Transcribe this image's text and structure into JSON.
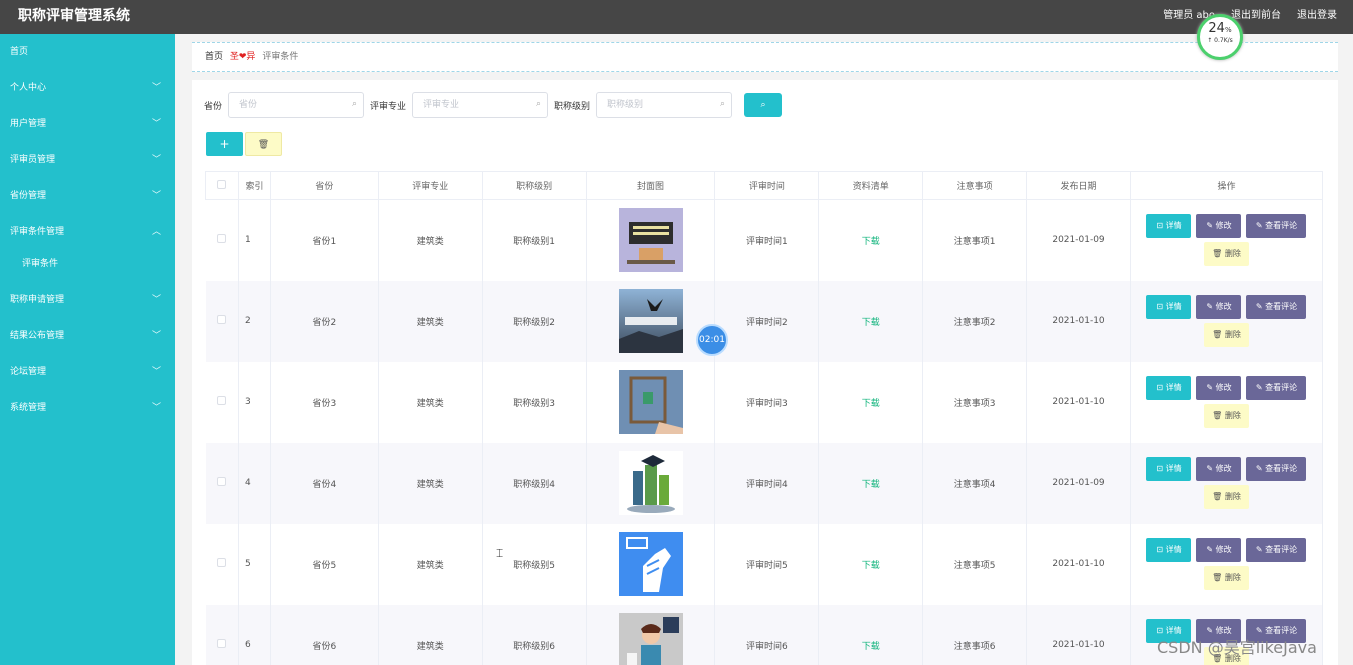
{
  "app": {
    "title": "职称评审管理系统"
  },
  "topbar": {
    "admin_label": "管理员 abo",
    "back_front": "退出到前台",
    "logout": "退出登录"
  },
  "sidebar": {
    "items": [
      {
        "label": "首页",
        "chevron": ""
      },
      {
        "label": "个人中心",
        "chevron": "﹀"
      },
      {
        "label": "用户管理",
        "chevron": "﹀"
      },
      {
        "label": "评审员管理",
        "chevron": "﹀"
      },
      {
        "label": "省份管理",
        "chevron": "﹀"
      },
      {
        "label": "评审条件管理",
        "chevron": "︿"
      },
      {
        "label": "评审条件",
        "chevron": ""
      },
      {
        "label": "职称申请管理",
        "chevron": "﹀"
      },
      {
        "label": "结果公布管理",
        "chevron": "﹀"
      },
      {
        "label": "论坛管理",
        "chevron": "﹀"
      },
      {
        "label": "系统管理",
        "chevron": "﹀"
      }
    ]
  },
  "breadcrumb": {
    "home": "首页",
    "sep": "圣❤异",
    "current": "评审条件"
  },
  "search": {
    "province_label": "省份",
    "province_placeholder": "省份",
    "major_label": "评审专业",
    "major_placeholder": "评审专业",
    "level_label": "职称级别",
    "level_placeholder": "职称级别",
    "search_icon": "⌕"
  },
  "actions": {
    "add": "+",
    "delete": "🗑"
  },
  "table": {
    "headers": [
      "索引",
      "省份",
      "评审专业",
      "职称级别",
      "封面图",
      "评审时间",
      "资料清单",
      "注意事项",
      "发布日期",
      "操作"
    ],
    "rows": [
      {
        "idx": "1",
        "province": "省份1",
        "major": "建筑类",
        "level": "职称级别1",
        "time": "评审时间1",
        "file": "下载",
        "note": "注意事项1",
        "date": "2021-01-09"
      },
      {
        "idx": "2",
        "province": "省份2",
        "major": "建筑类",
        "level": "职称级别2",
        "time": "评审时间2",
        "file": "下载",
        "note": "注意事项2",
        "date": "2021-01-10"
      },
      {
        "idx": "3",
        "province": "省份3",
        "major": "建筑类",
        "level": "职称级别3",
        "time": "评审时间3",
        "file": "下载",
        "note": "注意事项3",
        "date": "2021-01-10"
      },
      {
        "idx": "4",
        "province": "省份4",
        "major": "建筑类",
        "level": "职称级别4",
        "time": "评审时间4",
        "file": "下载",
        "note": "注意事项4",
        "date": "2021-01-09"
      },
      {
        "idx": "5",
        "province": "省份5",
        "major": "建筑类",
        "level": "职称级别5",
        "time": "评审时间5",
        "file": "下载",
        "note": "注意事项5",
        "date": "2021-01-10"
      },
      {
        "idx": "6",
        "province": "省份6",
        "major": "建筑类",
        "level": "职称级别6",
        "time": "评审时间6",
        "file": "下载",
        "note": "注意事项6",
        "date": "2021-01-10"
      }
    ],
    "ops": {
      "detail": "详情",
      "edit": "修改",
      "review": "查看评论",
      "delete": "删除"
    }
  },
  "overlay": {
    "speed_pct": "24",
    "speed_unit": "%",
    "speed_rate": "↑ 0.7K/s",
    "timer": "02:01",
    "watermark": "CSDN @昊宫likeJava"
  },
  "colors": {
    "accent": "#23c0cc",
    "topbar": "#464646",
    "purple": "#6a6798",
    "yellow": "#fdfbc7",
    "download": "#0cb37a"
  }
}
